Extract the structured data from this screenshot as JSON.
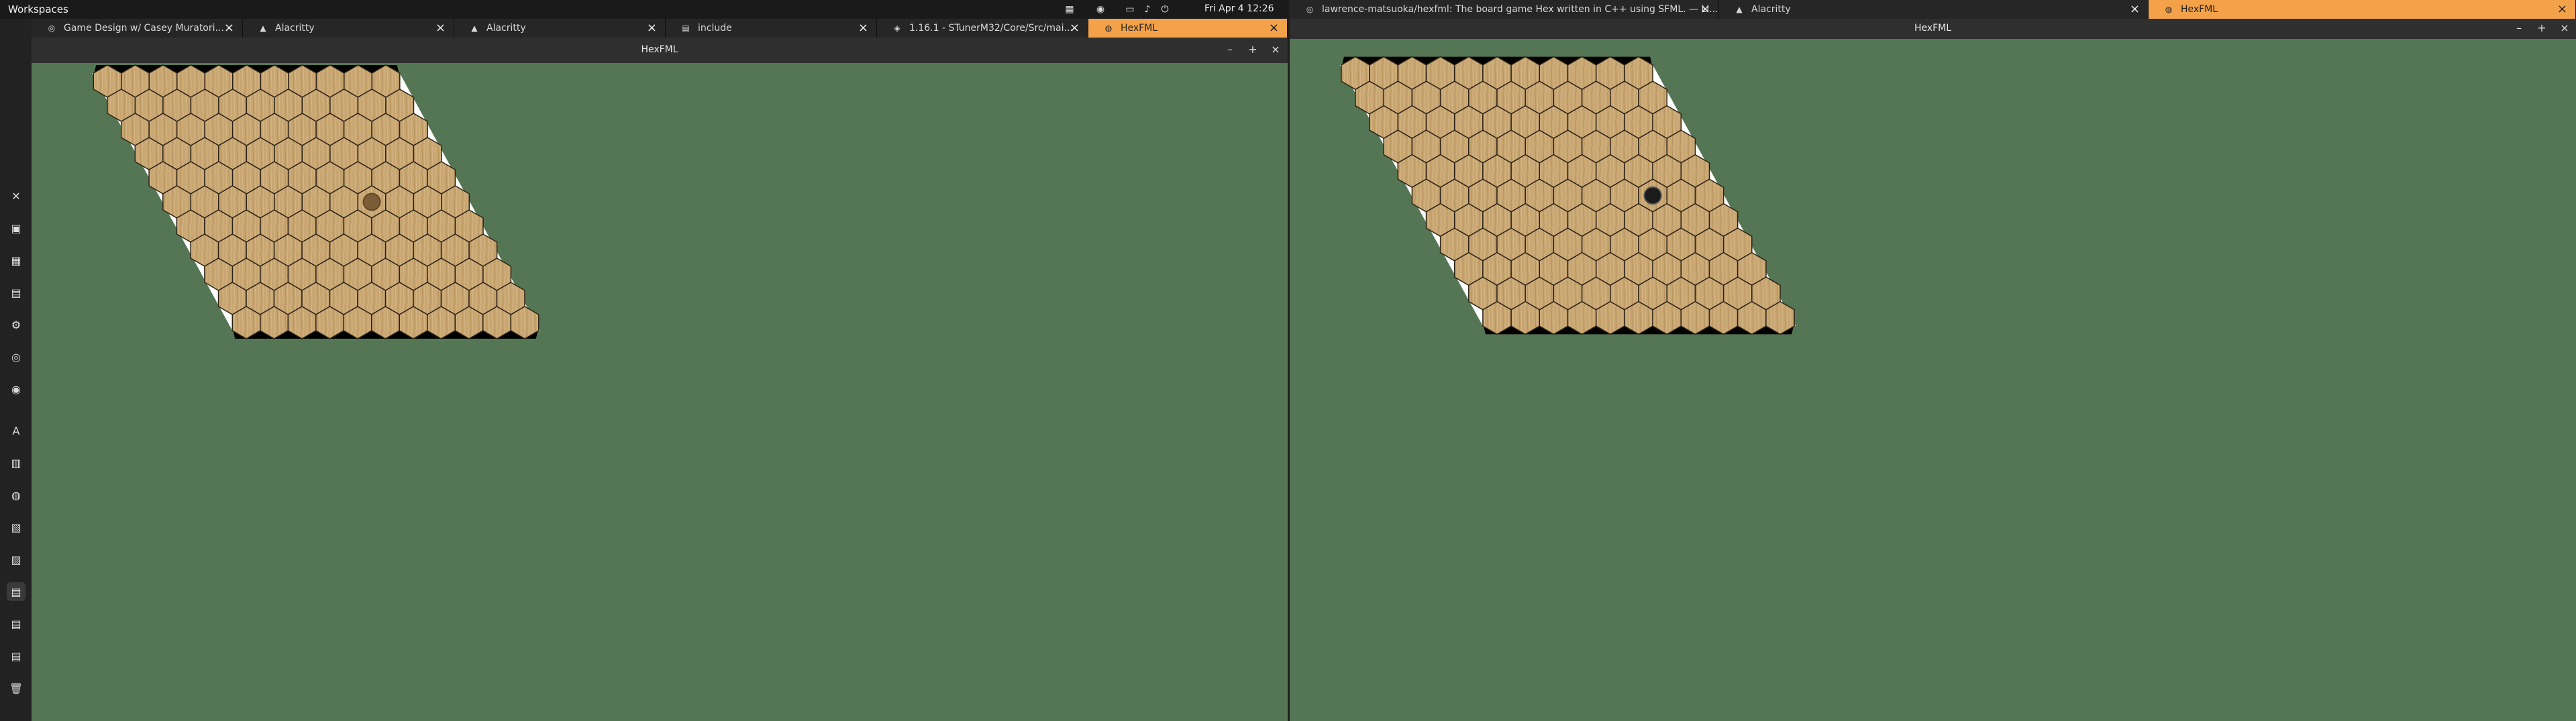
{
  "top_bar": {
    "workspaces_label": "Workspaces",
    "clock": "Fri Apr 4  12:26",
    "tray_icons": [
      "grid-icon",
      "discord-icon",
      "window-icon",
      "volume-icon",
      "power-icon"
    ]
  },
  "dock": {
    "icons": [
      "vscode-icon",
      "terminal-icon",
      "apps-icon",
      "files-icon",
      "settings-icon",
      "browser-icon",
      "chrome-icon",
      "alacritty-icon",
      "docs-icon",
      "discord-icon",
      "slides-icon",
      "notes-icon",
      "file-icon",
      "document-icon",
      "pdf-icon",
      "trash-icon"
    ]
  },
  "left_tabs": [
    {
      "label": "Game Design w/ Casey Muratori...",
      "icon": "browser-icon",
      "active": false
    },
    {
      "label": "Alacritty",
      "icon": "alacritty-icon",
      "active": false
    },
    {
      "label": "Alacritty",
      "icon": "alacritty-icon",
      "active": false
    },
    {
      "label": "include",
      "icon": "folder-icon",
      "active": false
    },
    {
      "label": "1.16.1 - STunerM32/Core/Src/mai...",
      "icon": "editor-icon",
      "active": false
    },
    {
      "label": "HexFML",
      "icon": "app-icon",
      "active": true
    }
  ],
  "right_tabs": [
    {
      "label": "lawrence-matsuoka/hexfml: The board game Hex written in C++ using SFML. — Li...",
      "icon": "browser-icon",
      "active": false
    },
    {
      "label": "Alacritty",
      "icon": "alacritty-icon",
      "active": false
    },
    {
      "label": "HexFML",
      "icon": "app-icon",
      "active": true
    }
  ],
  "left_window": {
    "title": "HexFML",
    "min": "–",
    "max": "+",
    "close": "×"
  },
  "right_window": {
    "title": "HexFML",
    "min": "–",
    "max": "+",
    "close": "×"
  },
  "colors": {
    "board_bg": "#557654",
    "hex_fill": "#c8a672",
    "hex_stroke": "#2b2217",
    "edge_black": "#000000",
    "edge_white": "#ffffff",
    "accent_tab": "#f3a24a"
  },
  "boards": [
    {
      "name": "left-board",
      "rows": 11,
      "cols": 11,
      "pieces": [
        {
          "row": 5,
          "col": 7,
          "color": "brown"
        }
      ]
    },
    {
      "name": "right-board",
      "rows": 11,
      "cols": 11,
      "pieces": [
        {
          "row": 5,
          "col": 8,
          "color": "black"
        }
      ]
    }
  ]
}
